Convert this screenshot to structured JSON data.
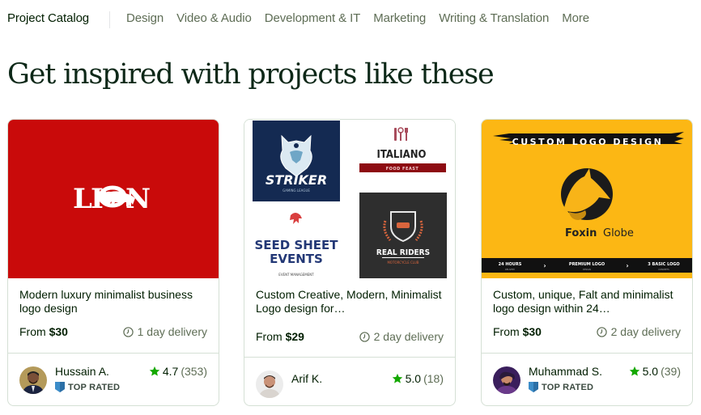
{
  "nav": {
    "brand": "Project Catalog",
    "items": [
      "Design",
      "Video & Audio",
      "Development & IT",
      "Marketing",
      "Writing & Translation",
      "More"
    ]
  },
  "headline": "Get inspired with projects like these",
  "colors": {
    "star": "#14a800",
    "text_primary": "#001e00",
    "text_muted": "#5e6d55",
    "top_rated_badge": "#3c8dc9"
  },
  "cards": [
    {
      "thumbnail": {
        "description": "Red background with white LION logo with lion illustration",
        "logo_text": "LION"
      },
      "title": "Modern luxury minimalist business logo design",
      "price_prefix": "From",
      "price": "$30",
      "delivery": "1 day delivery",
      "seller": {
        "name": "Hussain A.",
        "badge": "TOP RATED"
      },
      "rating": "4.7",
      "reviews": "(353)"
    },
    {
      "thumbnail": {
        "description": "Collage of four logo samples",
        "logos": [
          {
            "name": "STRIKER",
            "sub": "GAMING LEAGUE"
          },
          {
            "name": "ITALIANO",
            "sub": "FOOD FEAST"
          },
          {
            "name": "SEED SHEET EVENTS",
            "sub": "EVENT MANAGEMENT"
          },
          {
            "name": "REAL RIDERS",
            "sub": "MOTORCYCLE CLUB"
          }
        ]
      },
      "title": "Custom Creative, Modern, Minimalist Logo design for…",
      "price_prefix": "From",
      "price": "$29",
      "delivery": "2 day delivery",
      "seller": {
        "name": "Arif K.",
        "badge": ""
      },
      "rating": "5.0",
      "reviews": "(18)"
    },
    {
      "thumbnail": {
        "description": "Yellow background with fox silhouette logo",
        "banner": "CUSTOM LOGO DESIGN",
        "brand_bold": "Foxin",
        "brand_light": "Globe",
        "steps": [
          {
            "label": "24 HOURS",
            "sub": "DELIVERY"
          },
          {
            "label": "PREMIUM LOGO",
            "sub": "DESIGN"
          },
          {
            "label": "3 BASIC LOGO",
            "sub": "CONCEPTS"
          }
        ]
      },
      "title": "Custom, unique, Falt and minimalist logo design within 24…",
      "price_prefix": "From",
      "price": "$30",
      "delivery": "2 day delivery",
      "seller": {
        "name": "Muhammad S.",
        "badge": "TOP RATED"
      },
      "rating": "5.0",
      "reviews": "(39)"
    }
  ]
}
